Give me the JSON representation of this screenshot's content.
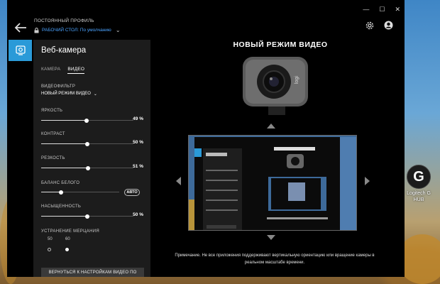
{
  "window": {
    "profile_title": "ПОСТОЯННЫЙ ПРОФИЛЬ",
    "profile_name": "РАБОЧИЙ СТОЛ: По умолчанию",
    "controls": [
      "—",
      "☐",
      "✕"
    ]
  },
  "panel": {
    "title": "Веб-камера",
    "tabs": [
      {
        "label": "КАМЕРА",
        "active": false
      },
      {
        "label": "ВИДЕО",
        "active": true
      }
    ],
    "video_filter_label": "ВИДЕОФИЛЬТР",
    "video_filter_value": "НОВЫЙ РЕЖИМ ВИДЕО",
    "brightness": {
      "label": "ЯРКОСТЬ",
      "value_text": "49 %",
      "level": 0.49
    },
    "contrast": {
      "label": "КОНТРАСТ",
      "value_text": "50 %",
      "level": 0.5
    },
    "sharpness": {
      "label": "РЕЗКОСТЬ",
      "value_text": "51 %",
      "level": 0.51
    },
    "white_balance": {
      "label": "БАЛАНС БЕЛОГО",
      "level": 0.25,
      "auto_label": "АВТО"
    },
    "saturation": {
      "label": "НАСЫЩЕННОСТЬ",
      "value_text": "50 %",
      "level": 0.5
    },
    "flicker": {
      "label": "УСТРАНЕНИЕ МЕРЦАНИЯ",
      "options": [
        "50",
        "60"
      ],
      "selected": "60"
    },
    "reset_label": "ВЕРНУТЬСЯ К НАСТРОЙКАМ ВИДЕО ПО"
  },
  "main": {
    "title": "НОВЫЙ РЕЖИМ ВИДЕО",
    "note": "Примечание. Не все приложения поддерживают вертикальную ориентацию или вращение камеры в реальном масштабе времени."
  },
  "desktop": {
    "icon_label": "Logitech G HUB"
  },
  "colors": {
    "accent": "#2a9ad8",
    "link": "#4ba3ff",
    "panel_bg": "#1c1c1c"
  }
}
